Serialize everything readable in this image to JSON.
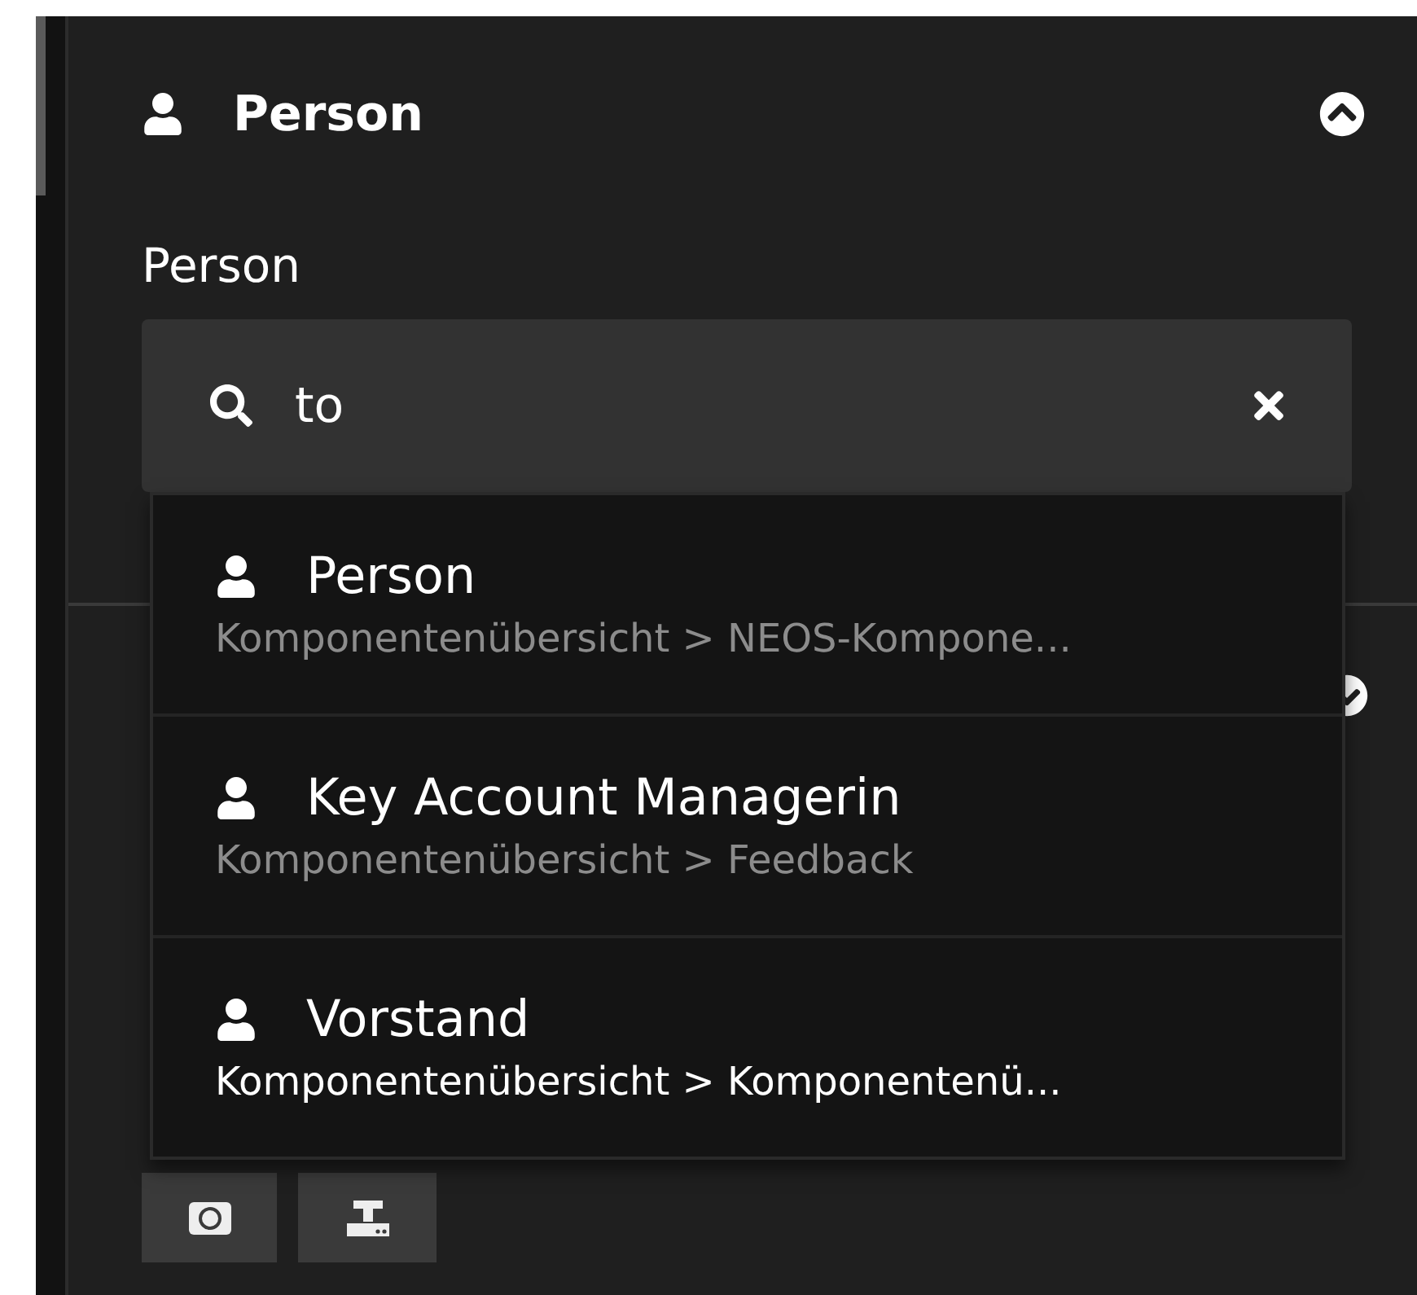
{
  "section": {
    "title": "Person",
    "expanded": true
  },
  "field": {
    "label": "Person",
    "value": "to"
  },
  "results": [
    {
      "title": "Person",
      "path": "Komponentenübersicht > NEOS-Kompone...",
      "selected": false
    },
    {
      "title": "Key Account Managerin",
      "path": "Komponentenübersicht > Feedback",
      "selected": false
    },
    {
      "title": "Vorstand",
      "path": "Komponentenübersicht > Komponentenü...",
      "selected": true
    }
  ]
}
